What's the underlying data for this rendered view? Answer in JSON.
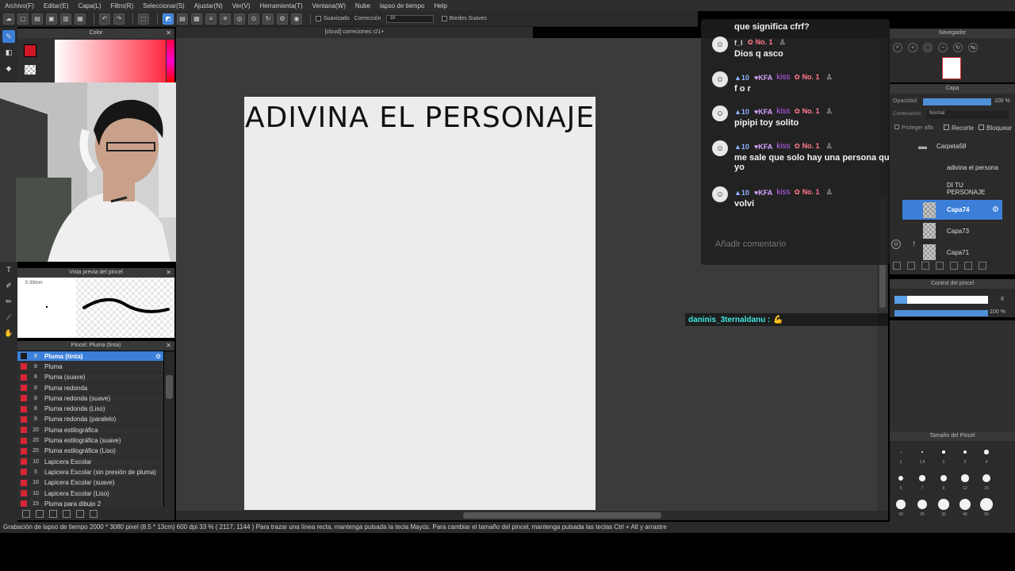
{
  "menu": [
    "Archivo(F)",
    "Editar(E)",
    "Capa(L)",
    "Filtro(R)",
    "Seleccionar(S)",
    "Ajustar(N)",
    "Ver(V)",
    "Herramienta(T)",
    "Ventana(W)",
    "Nube",
    "lapso de tiempo",
    "Help"
  ],
  "toolbar": {
    "suavizado_label": "Suavizado",
    "correccion_label": "Corrección",
    "correccion_value": "18",
    "bordes_label": "Bordes Suaves"
  },
  "document_tab": "[cloud] correciones r21+",
  "color_panel": {
    "title": "Color",
    "main_color": "#d01827"
  },
  "brush_preview": {
    "title": "Vista previa del pincel",
    "size": "0.39mm"
  },
  "brush_panel": {
    "title": "Pincel: Pluma (tinta)",
    "items": [
      {
        "size": "8",
        "name": "Pluma (tinta)"
      },
      {
        "size": "8",
        "name": "Pluma"
      },
      {
        "size": "8",
        "name": "Pluma (suave)"
      },
      {
        "size": "8",
        "name": "Pluma redonda"
      },
      {
        "size": "8",
        "name": "Pluma redonda (suave)"
      },
      {
        "size": "8",
        "name": "Pluma redonda (Liso)"
      },
      {
        "size": "8",
        "name": "Pluma redonda (paralelo)"
      },
      {
        "size": "20",
        "name": "Pluma estilográfica"
      },
      {
        "size": "20",
        "name": "Pluma estilográfica (suave)"
      },
      {
        "size": "20",
        "name": "Pluma estilográfica (Liso)"
      },
      {
        "size": "10",
        "name": "Lapicera Escolar"
      },
      {
        "size": "5",
        "name": "Lapicera Escolar (sin presión de pluma)"
      },
      {
        "size": "10",
        "name": "Lapicera Escolar (suave)"
      },
      {
        "size": "10",
        "name": "Lapicera Escolar (Liso)"
      },
      {
        "size": "15",
        "name": "Pluma para dibujo 2"
      }
    ]
  },
  "canvas": {
    "title": "ADIVINA EL PERSONAJE"
  },
  "status_bar": "Grabación de lapso de tiempo  2000 * 3080 pixel  (8.5 * 13cm)  600 dpi  33 %  ( 2117, 1144 )  Para trazar una línea recta, mantenga pulsada la tecla Mayús. Para cambiar el tamaño del pincel, mantenga pulsada las teclas Ctrl + Alt y arrastre",
  "chat": {
    "top_text": "que significa cfrf?",
    "messages": [
      {
        "user": "f_l",
        "rank": "No. 1",
        "text": "Dios q asco",
        "badges": false
      },
      {
        "level": "10",
        "kfa": "KFA",
        "kiss": "kiss",
        "rank": "No. 1",
        "text": "f o r",
        "badges": true
      },
      {
        "level": "10",
        "kfa": "KFA",
        "kiss": "kiss",
        "rank": "No. 1",
        "text": "pipipi toy solito",
        "badges": true
      },
      {
        "level": "10",
        "kfa": "KFA",
        "kiss": "kiss",
        "rank": "No. 1",
        "text": "me sale que solo hay una persona que soy yo",
        "badges": true
      },
      {
        "level": "10",
        "kfa": "KFA",
        "kiss": "kiss",
        "rank": "No. 1",
        "text": "volvi",
        "badges": true
      }
    ],
    "input_placeholder": "Añadir comentario"
  },
  "external_msg": {
    "user": "daninis_3ternaldanu :",
    "emoji": "💪"
  },
  "navigator": {
    "title": "Navegador"
  },
  "layers": {
    "title": "Capa",
    "opacity_label": "Opacidad",
    "opacity_value": "100 %",
    "blend_label": "Combinación",
    "blend_value": "Normal",
    "protect_label": "Proteger alfa",
    "clip_label": "Recorte",
    "lock_label": "Bloquear",
    "items": [
      {
        "name": "Carpeta58",
        "type": "folder"
      },
      {
        "name": "adivina el persona",
        "type": "text"
      },
      {
        "name": "DI TU PERSONAJE",
        "type": "text"
      },
      {
        "name": "Capa74",
        "type": "raster",
        "active": true
      },
      {
        "name": "Capa73",
        "type": "raster"
      },
      {
        "name": "Capa71",
        "type": "raster"
      }
    ]
  },
  "brush_control": {
    "title": "Control del pincel",
    "size_value": "8",
    "opacity_value": "100 %"
  },
  "brush_size": {
    "title": "Tamaño del Pincel",
    "sizes": [
      "1",
      "1.5",
      "2",
      "3",
      "4",
      "5",
      "7",
      "8",
      "12",
      "15",
      "20",
      "25",
      "30",
      "40",
      "50"
    ]
  }
}
